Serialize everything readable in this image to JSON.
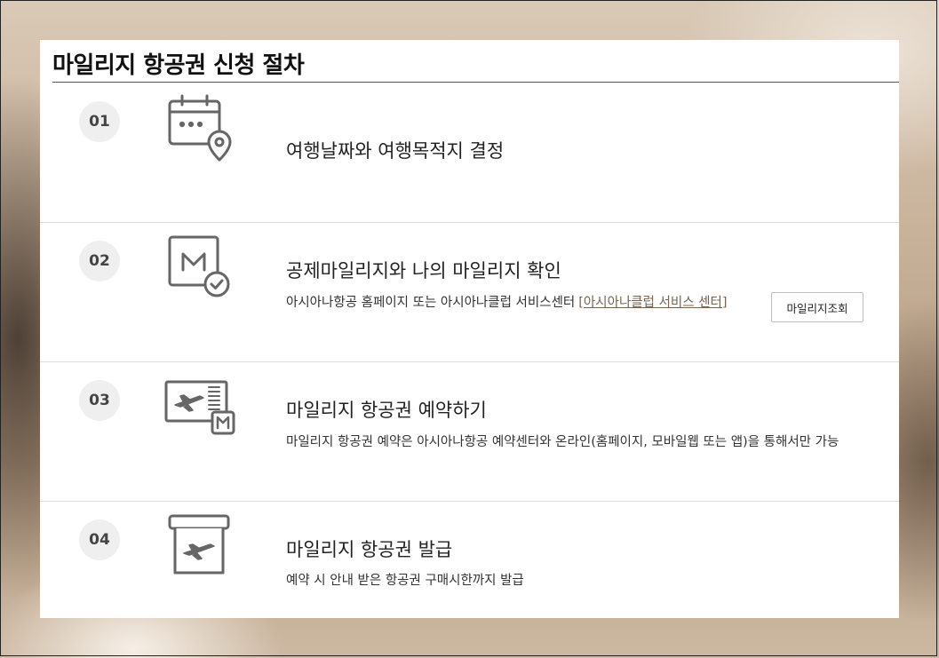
{
  "page_title": "마일리지 항공권 신청 절차",
  "steps": [
    {
      "number": "01",
      "icon": "calendar-location-icon",
      "title": "여행날짜와 여행목적지 결정"
    },
    {
      "number": "02",
      "icon": "mileage-check-icon",
      "title": "공제마일리지와 나의 마일리지 확인",
      "description": "아시아나항공 홈페이지 또는 아시아나클럽 서비스센터",
      "link_label": "[아시아나클럽 서비스 센터]",
      "button_label": "마일리지조회"
    },
    {
      "number": "03",
      "icon": "ticket-mileage-icon",
      "title": "마일리지 항공권 예약하기",
      "description": "마일리지 항공권 예약은 아시아나항공 예약센터와 온라인(홈페이지, 모바일웹 또는 앱)을 통해서만 가능"
    },
    {
      "number": "04",
      "icon": "ticket-issue-icon",
      "title": "마일리지 항공권 발급",
      "description": "예약 시 안내 받은 항공권 구매시한까지 발급"
    }
  ],
  "colors": {
    "icon_stroke": "#666666",
    "link": "#7a6450",
    "number_badge_bg": "#efefef"
  }
}
